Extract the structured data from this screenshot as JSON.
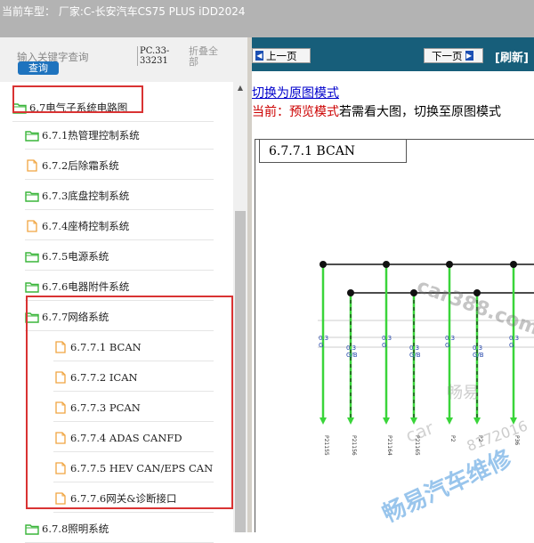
{
  "window": {
    "title": "当前车型：  厂家:C-长安汽车CS75 PLUS iDD2024"
  },
  "search": {
    "placeholder": "输入关键字查询",
    "button_label": "查询"
  },
  "pc_code": "PC.33-33231",
  "fold_all_label": "折叠全部",
  "tree": {
    "items": [
      {
        "label": "6.7电气子系统电路图",
        "type": "folder"
      },
      {
        "label": "6.7.1热管理控制系统",
        "type": "folder"
      },
      {
        "label": "6.7.2后除霜系统",
        "type": "doc"
      },
      {
        "label": "6.7.3底盘控制系统",
        "type": "folder"
      },
      {
        "label": "6.7.4座椅控制系统",
        "type": "doc"
      },
      {
        "label": "6.7.5电源系统",
        "type": "folder"
      },
      {
        "label": "6.7.6电器附件系统",
        "type": "folder"
      },
      {
        "label": "6.7.7网络系统",
        "type": "folder"
      },
      {
        "label": "6.7.7.1 BCAN",
        "type": "doc"
      },
      {
        "label": "6.7.7.2 ICAN",
        "type": "doc"
      },
      {
        "label": "6.7.7.3 PCAN",
        "type": "doc"
      },
      {
        "label": "6.7.7.4 ADAS CANFD",
        "type": "doc"
      },
      {
        "label": "6.7.7.5 HEV CAN/EPS CAN",
        "type": "doc"
      },
      {
        "label": "6.7.7.6网关&诊断接口",
        "type": "doc"
      },
      {
        "label": "6.7.8照明系统",
        "type": "folder"
      }
    ]
  },
  "nav": {
    "prev_label": "上一页",
    "next_label": "下一页",
    "refresh_label": "[刷新]"
  },
  "content": {
    "switch_link": "切换为原图模式",
    "mode_prefix": "当前：预览模式",
    "mode_suffix": "若需看大图，切换至原图模式",
    "diagram_title": "6.7.7.1 BCAN"
  },
  "diagram": {
    "wire_labels": [
      "0.3\nG",
      "0.3\nG/B",
      "0.3\nG",
      "0.3\nG/B",
      "0.3\nG",
      "0.3\nG/B",
      "0.3\nG",
      "0.3\nG/B"
    ],
    "connectors": [
      "P21155",
      "P21156",
      "P21164",
      "P21165",
      "P2",
      "P2",
      "P36",
      "P36"
    ],
    "watermarks": [
      "car388.com",
      "畅易",
      "car",
      "畅易汽车维修",
      "8172016"
    ]
  },
  "colors": {
    "highlight": "#d93333",
    "navbar": "#175e7a",
    "wire_green": "#3ad53a",
    "search_btn": "#1e73be",
    "folder": "#3ab53a",
    "doc": "#f0a540"
  }
}
